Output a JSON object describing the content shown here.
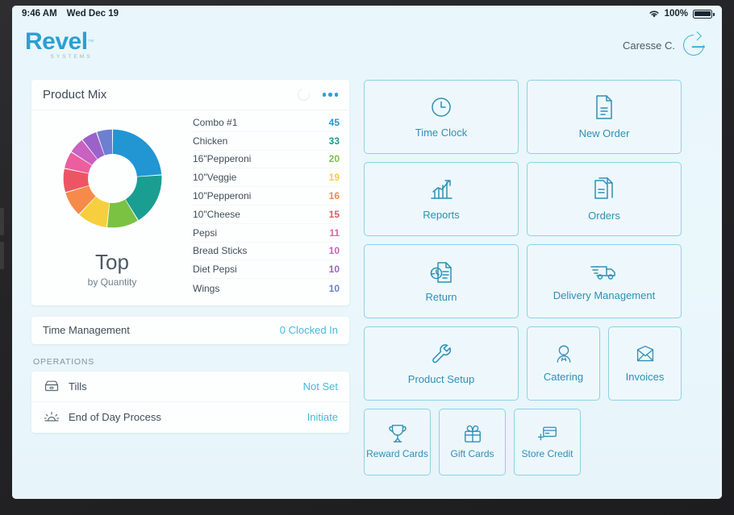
{
  "statusbar": {
    "time": "9:46 AM",
    "date": "Wed Dec 19",
    "wifi_icon": "wifi-icon",
    "battery_percent": "100%",
    "battery_icon": "battery-full-icon"
  },
  "header": {
    "logo_word": "Revel",
    "logo_tm": "™",
    "logo_sub": "SYSTEMS",
    "user_name": "Caresse C.",
    "logout_icon": "logout-icon"
  },
  "product_mix": {
    "title": "Product Mix",
    "refresh_icon": "refresh-icon",
    "more_icon": "more-options-icon",
    "top_label": "Top",
    "sub_label": "by Quantity",
    "items": [
      {
        "name": "Combo #1",
        "value": "45",
        "color": "#2196d3"
      },
      {
        "name": "Chicken",
        "value": "33",
        "color": "#1a9e91"
      },
      {
        "name": "16\"Pepperoni",
        "value": "20",
        "color": "#7cc242"
      },
      {
        "name": "10\"Veggie",
        "value": "19",
        "color": "#f7ce3e"
      },
      {
        "name": "10\"Pepperoni",
        "value": "16",
        "color": "#f58a4b"
      },
      {
        "name": "10\"Cheese",
        "value": "15",
        "color": "#ed5565"
      },
      {
        "name": "Pepsi",
        "value": "11",
        "color": "#ec5e9e"
      },
      {
        "name": "Bread Sticks",
        "value": "10",
        "color": "#c861c0"
      },
      {
        "name": "Diet Pepsi",
        "value": "10",
        "color": "#9b63c9"
      },
      {
        "name": "Wings",
        "value": "10",
        "color": "#6d7fd0"
      }
    ]
  },
  "chart_data": {
    "type": "pie",
    "title": "Product Mix",
    "subtitle": "Top by Quantity",
    "categories": [
      "Combo #1",
      "Chicken",
      "16\"Pepperoni",
      "10\"Veggie",
      "10\"Pepperoni",
      "10\"Cheese",
      "Pepsi",
      "Bread Sticks",
      "Diet Pepsi",
      "Wings"
    ],
    "values": [
      45,
      33,
      20,
      19,
      16,
      15,
      11,
      10,
      10,
      10
    ],
    "colors": [
      "#2196d3",
      "#1a9e91",
      "#7cc242",
      "#f7ce3e",
      "#f58a4b",
      "#ed5565",
      "#ec5e9e",
      "#c861c0",
      "#9b63c9",
      "#6d7fd0"
    ],
    "legend": "right-list",
    "donut": true
  },
  "time_management": {
    "label": "Time Management",
    "value": "0 Clocked In"
  },
  "operations": {
    "section_label": "OPERATIONS",
    "rows": [
      {
        "icon": "till-drawer-icon",
        "label": "Tills",
        "value": "Not Set"
      },
      {
        "icon": "sunrise-icon",
        "label": "End of Day Process",
        "value": "Initiate"
      }
    ]
  },
  "tiles": [
    {
      "label": "Time Clock",
      "icon": "clock-icon",
      "size": "w2"
    },
    {
      "label": "New Order",
      "icon": "document-icon",
      "size": "w2"
    },
    {
      "label": "Reports",
      "icon": "bar-chart-icon",
      "size": "w2"
    },
    {
      "label": "Orders",
      "icon": "documents-icon",
      "size": "w2"
    },
    {
      "label": "Return",
      "icon": "return-icon",
      "size": "w2"
    },
    {
      "label": "Delivery Management",
      "icon": "truck-icon",
      "size": "w2"
    },
    {
      "label": "Product Setup",
      "icon": "wrench-icon",
      "size": "w2"
    },
    {
      "label": "Catering",
      "icon": "chef-icon",
      "size": "w1"
    },
    {
      "label": "Invoices",
      "icon": "envelope-icon",
      "size": "w1"
    },
    {
      "label": "Reward Cards",
      "icon": "trophy-icon",
      "size": "sq"
    },
    {
      "label": "Gift Cards",
      "icon": "gift-icon",
      "size": "sq"
    },
    {
      "label": "Store Credit",
      "icon": "credit-card-plus-icon",
      "size": "sq"
    }
  ],
  "colors": {
    "brand": "#2c9fd4",
    "tile_border": "#8fd0e4",
    "tile_text": "#2f8fb8",
    "link": "#49b8d8",
    "screen_bg": "#eaf6fa"
  }
}
